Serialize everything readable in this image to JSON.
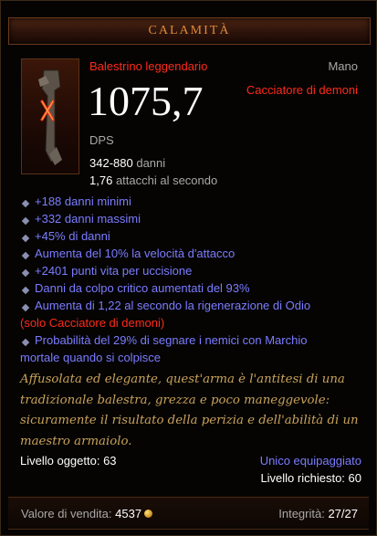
{
  "title": "CALAMITÀ",
  "item": {
    "rarity_type": "Balestrino leggendario",
    "slot": "Mano",
    "dps_value": "1075,7",
    "dps_label": "DPS",
    "class_req": "Cacciatore di demoni",
    "damage_range": "342-880",
    "damage_label": "danni",
    "attacks_value": "1,76",
    "attacks_label": "attacchi al secondo"
  },
  "affixes": [
    {
      "text": "+188 danni minimi",
      "color": "blue"
    },
    {
      "text": "+332 danni massimi",
      "color": "blue"
    },
    {
      "text": "+45% di danni",
      "color": "blue"
    },
    {
      "text": "Aumenta del 10% la velocità d'attacco",
      "color": "blue"
    },
    {
      "text": "+2401 punti vita per uccisione",
      "color": "blue"
    },
    {
      "text": "Danni da colpo critico aumentati del 93%",
      "color": "blue"
    }
  ],
  "affix_odio": {
    "line1": "Aumenta di 1,22 al secondo la rigenerazione di Odio",
    "line2": "(solo Cacciatore di demoni)"
  },
  "affix_marchio": {
    "line1": "Probabilità del 29% di segnare i nemici con Marchio",
    "line2": "mortale quando si colpisce"
  },
  "flavor": "Affusolata ed elegante, quest'arma è l'antitesi di una tradizionale balestra, grezza e poco maneggevole: sicuramente il risultato della perizia e dell'abilità di un maestro armaiolo.",
  "item_level_label": "Livello oggetto: 63",
  "unique_equipped": "Unico equipaggiato",
  "required_level": "Livello richiesto: 60",
  "sell_label": "Valore di vendita:",
  "sell_value": "4537",
  "durability_label": "Integrità:",
  "durability_value": "27/27",
  "colors": {
    "title": "#e0883a",
    "legendary_red": "#ff2a1a",
    "affix_blue": "#7b7cff",
    "flavor_gold": "#c9a25a"
  },
  "icons": [
    "hand-crossbow-icon",
    "affix-bullet-icon",
    "gold-coin-icon"
  ]
}
